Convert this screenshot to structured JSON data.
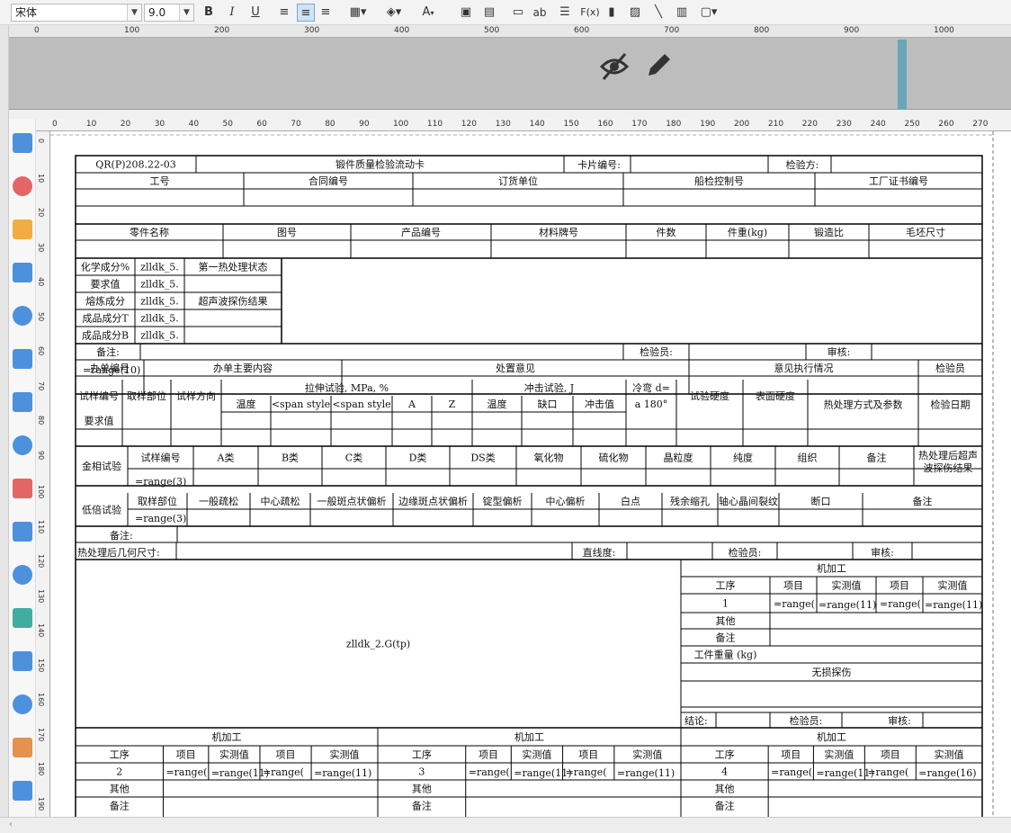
{
  "toolbar": {
    "font_name": "宋体",
    "font_size": "9.0",
    "bold": "B",
    "italic": "I",
    "underline": "U",
    "text_tool": "ab",
    "formula": "F(x)",
    "text_color_icon": "A"
  },
  "ruler_top": [
    "0",
    "100",
    "200",
    "300",
    "400",
    "500",
    "600",
    "700",
    "800",
    "900",
    "1000"
  ],
  "ruler_sheet": [
    "0",
    "10",
    "20",
    "30",
    "40",
    "50",
    "60",
    "70",
    "80",
    "90",
    "100",
    "110",
    "120",
    "130",
    "140",
    "150",
    "160",
    "170",
    "180",
    "190",
    "200",
    "210",
    "220",
    "230",
    "240",
    "250",
    "260",
    "270"
  ],
  "ruler_left": [
    "0",
    "10",
    "20",
    "30",
    "40",
    "50",
    "60",
    "70",
    "80",
    "90",
    "100",
    "110",
    "120",
    "130",
    "140",
    "150",
    "160",
    "170",
    "180",
    "190"
  ],
  "form": {
    "r1": [
      "QR(P)208.22-03",
      "锻件质量检验流动卡",
      "卡片编号:",
      "检验方:"
    ],
    "r2": [
      "工号",
      "合同编号",
      "订货单位",
      "船检控制号",
      "工厂证书编号"
    ],
    "r4": [
      "零件名称",
      "图号",
      "产品编号",
      "材料牌号",
      "件数",
      "件重(kg)",
      "锻造比",
      "毛坯尺寸"
    ],
    "chem_labels": [
      "化学成分%",
      "要求值",
      "熔炼成分",
      "成品成分T",
      "成品成分B"
    ],
    "chem_vals": [
      "zlldk_5.",
      "zlldk_5.",
      "zlldk_5.",
      "zlldk_5.",
      "zlldk_5."
    ],
    "heat1": "第一热处理状态",
    "ut": "超声波探伤结果",
    "remark": "备注:",
    "inspector": "检验员:",
    "review": "审核:",
    "h_ban": [
      "办单编号",
      "办单主要内容",
      "处置意见",
      "意见执行情况",
      "检验员"
    ],
    "range10": "=range(10)",
    "mech": [
      "试样编号",
      "取样部位",
      "试样方向",
      "拉伸试验, MPa, %",
      "冲击试验, J",
      "冷弯 d=",
      "a 180°",
      "试验硬度",
      "表面硬度",
      "热处理方式及参数",
      "检验日期"
    ],
    "mech2": [
      "温度",
      "<span style",
      "<span style",
      "A",
      "Z",
      "温度",
      "缺口",
      "冲击值"
    ],
    "req": "要求值",
    "metal": [
      "金相试验",
      "试样编号",
      "A类",
      "B类",
      "C类",
      "D类",
      "DS类",
      "氧化物",
      "硫化物",
      "晶粒度",
      "纯度",
      "组织",
      "备注",
      "热处理后超声",
      "波探伤结果"
    ],
    "range3": "=range(3)",
    "low": [
      "低倍试验",
      "取样部位",
      "一般疏松",
      "中心疏松",
      "一般斑点状偏析",
      "边缘斑点状偏析",
      "锭型偏析",
      "中心偏析",
      "白点",
      "残余缩孔",
      "轴心晶间裂纹",
      "断口",
      "备注"
    ],
    "geo": [
      "热处理后几何尺寸:",
      "直线度:",
      "检验员:",
      "审核:"
    ],
    "image_formula": "zlldk_2.G(tp)",
    "mach": "机加工",
    "mach_h": [
      "工序",
      "项目",
      "实测值",
      "项目",
      "实测值"
    ],
    "seq1": "1",
    "rng_short": "=range(",
    "rng11": "=range(11)",
    "rng16": "=range(16)",
    "other": "其他",
    "note": "备注",
    "weight": "工件重量 (kg)",
    "ndt": "无损探伤",
    "concl": [
      "结论:",
      "检验员:",
      "审核:"
    ],
    "seqs": [
      "2",
      "3",
      "4"
    ]
  }
}
